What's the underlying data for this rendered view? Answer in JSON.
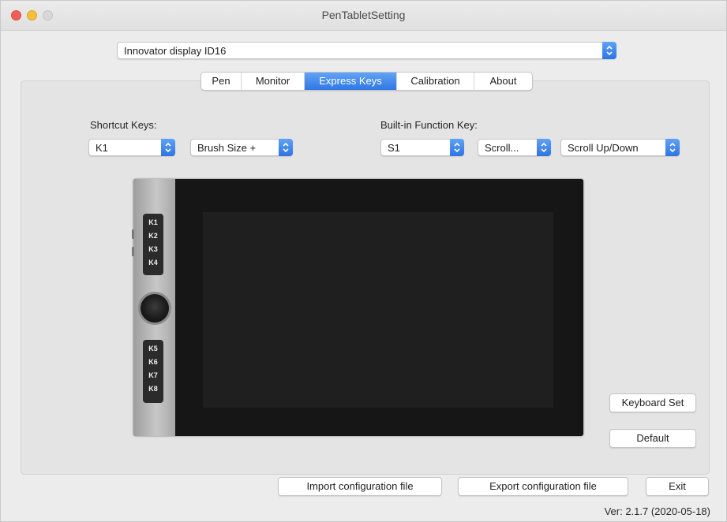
{
  "window": {
    "title": "PenTabletSetting"
  },
  "device": {
    "selected": "Innovator display ID16"
  },
  "tabs": [
    {
      "label": "Pen"
    },
    {
      "label": "Monitor"
    },
    {
      "label": "Express Keys"
    },
    {
      "label": "Calibration"
    },
    {
      "label": "About"
    }
  ],
  "active_tab": "Express Keys",
  "shortcut": {
    "label": "Shortcut Keys:",
    "key_value": "K1",
    "function_value": "Brush Size +"
  },
  "builtin": {
    "label": "Built-in Function Key:",
    "key_value": "S1",
    "function_value": "Scroll...",
    "direction_value": "Scroll Up/Down"
  },
  "tablet": {
    "keys_top": [
      "K1",
      "K2",
      "K3",
      "K4"
    ],
    "keys_bottom": [
      "K5",
      "K6",
      "K7",
      "K8"
    ]
  },
  "buttons": {
    "keyboard_set": "Keyboard Set",
    "default": "Default",
    "import": "Import configuration file",
    "export": "Export configuration file",
    "exit": "Exit"
  },
  "version": "Ver: 2.1.7 (2020-05-18)",
  "colors": {
    "accent": "#2f77e4",
    "tablet_body": "#161616",
    "bezel": "#b5b5b5"
  }
}
